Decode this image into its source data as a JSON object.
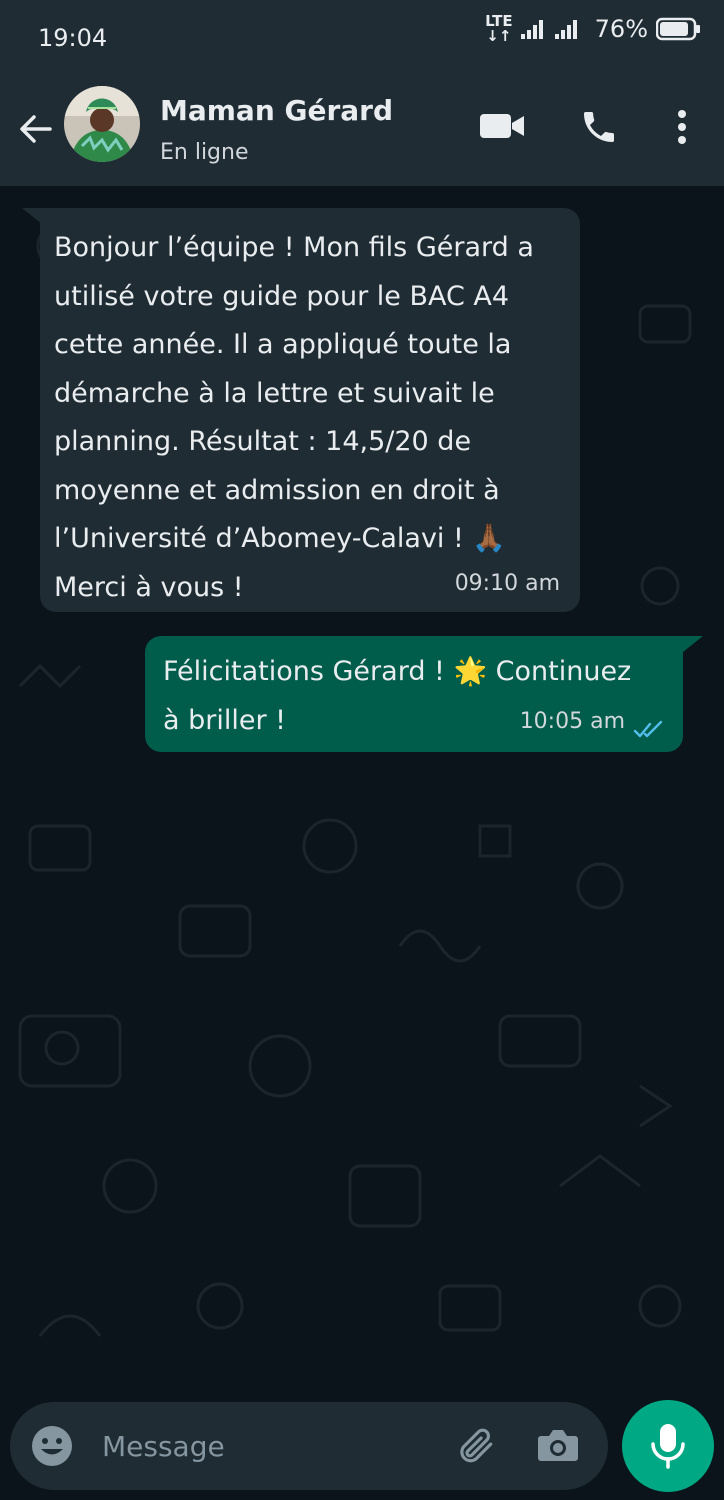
{
  "status_bar": {
    "time": "19:04",
    "network": "LTE",
    "battery": "76%"
  },
  "header": {
    "name": "Maman Gérard",
    "status": "En ligne"
  },
  "messages": [
    {
      "direction": "incoming",
      "lines": [
        "Bonjour l’équipe ! Mon fils Gérard a",
        "utilisé votre guide pour le BAC A4",
        "cette année. Il a appliqué toute la",
        "démarche à la lettre et suivait le",
        "planning. Résultat : 14,5/20 de",
        "moyenne et admission en droit à",
        "l’Université d’Abomey-Calavi ! 🙏🏾",
        "Merci à vous !"
      ],
      "time": "09:10 am"
    },
    {
      "direction": "outgoing",
      "lines": [
        "Félicitations Gérard ! 🌟 Continuez",
        "à briller !"
      ],
      "time": "10:05 am",
      "read_status": "read"
    }
  ],
  "composer": {
    "placeholder": "Message"
  },
  "colors": {
    "background": "#0b141a",
    "header": "#1f2c34",
    "incoming_bubble": "#1f2c34",
    "outgoing_bubble": "#005c4b",
    "accent": "#00a884",
    "read_ticks": "#53bdeb"
  },
  "icons": {
    "back": "arrow-left-icon",
    "video": "video-camera-icon",
    "call": "phone-icon",
    "menu": "more-vertical-icon",
    "emoji": "emoji-icon",
    "attach": "paperclip-icon",
    "camera": "camera-icon",
    "mic": "microphone-icon"
  }
}
